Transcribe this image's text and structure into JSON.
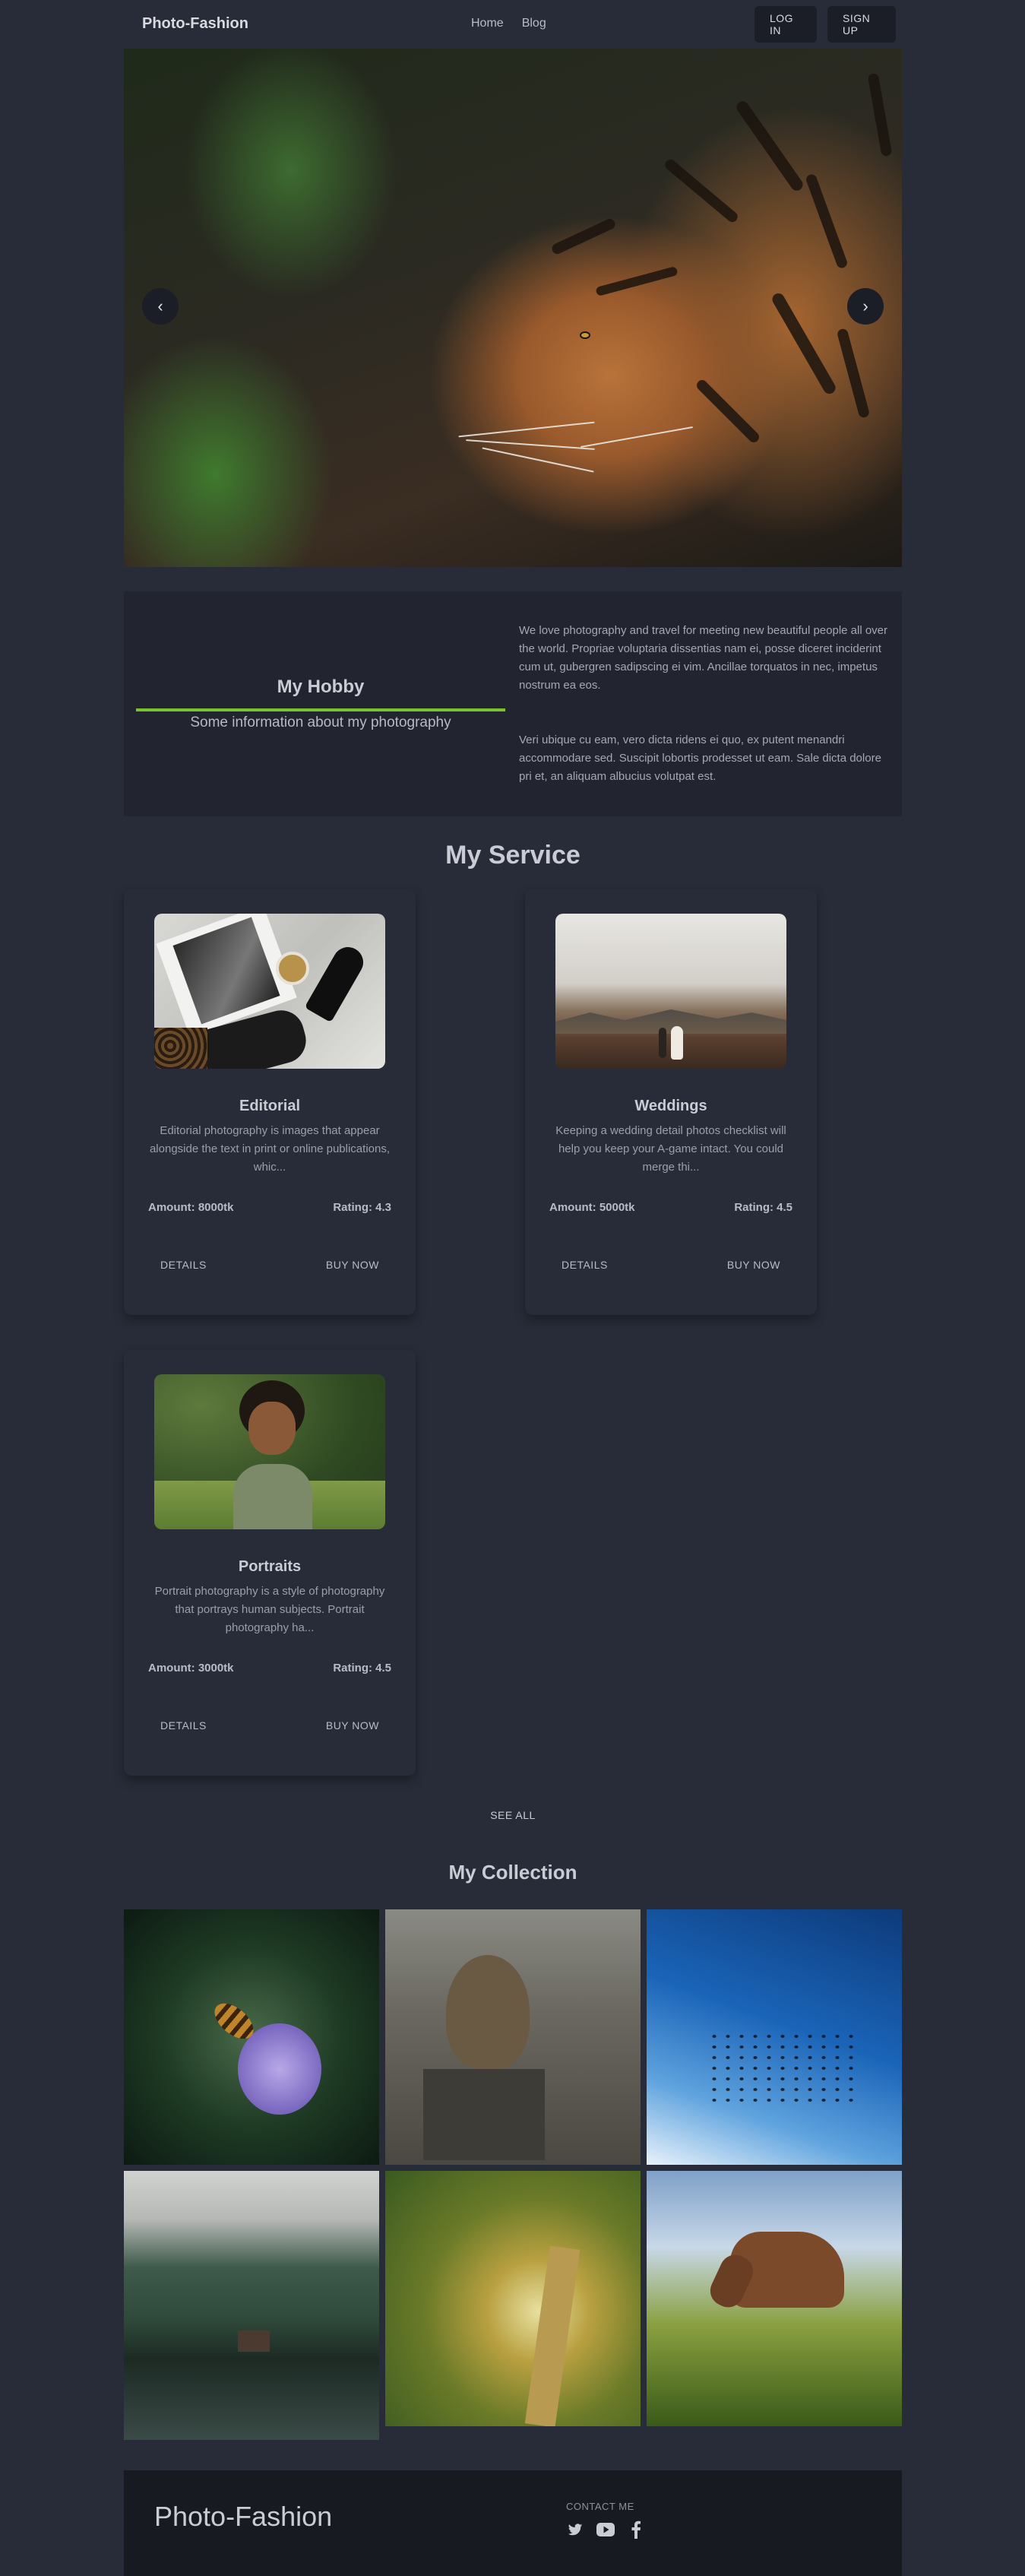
{
  "header": {
    "brand": "Photo-Fashion",
    "links": [
      "Home",
      "Blog"
    ],
    "login_label": "LOG IN",
    "signup_label": "SIGN UP"
  },
  "hero": {
    "prev_symbol": "‹",
    "next_symbol": "›",
    "image": "tiger-photo"
  },
  "hobby": {
    "title": "My Hobby",
    "subtitle": "Some information about my photography",
    "paragraph1": "We love photography and travel for meeting new beautiful people all over the world. Propriae voluptaria dissentias nam ei, posse diceret inciderint cum ut, gubergren sadipscing ei vim. Ancillae torquatos in nec, impetus nostrum ea eos.",
    "paragraph2": "Veri ubique cu eam, vero dicta ridens ei quo, ex putent menandri accommodare sed. Suscipit lobortis prodesset ut eam. Sale dicta dolore pri et, an aliquam albucius volutpat est.",
    "accent_color": "#7bc22f"
  },
  "services": {
    "title": "My Service",
    "items": [
      {
        "title": "Editorial",
        "description": "Editorial photography is images that appear alongside the text in print or online publications, whic...",
        "amount": "Amount: 8000tk",
        "rating": "Rating: 4.3",
        "details_label": "DETAILS",
        "buy_label": "BUY NOW"
      },
      {
        "title": "Weddings",
        "description": "Keeping a wedding detail photos checklist will help you keep your A-game intact. You could merge thi...",
        "amount": "Amount: 5000tk",
        "rating": "Rating: 4.5",
        "details_label": "DETAILS",
        "buy_label": "BUY NOW"
      },
      {
        "title": "Portraits",
        "description": "Portrait photography is a style of photography that portrays human subjects. Portrait photography ha...",
        "amount": "Amount: 3000tk",
        "rating": "Rating: 4.5",
        "details_label": "DETAILS",
        "buy_label": "BUY NOW"
      }
    ],
    "see_all_label": "SEE ALL"
  },
  "collection": {
    "title": "My Collection"
  },
  "footer": {
    "brand": "Photo-Fashion",
    "contact_label": "CONTACT ME",
    "socials": [
      "twitter-icon",
      "youtube-icon",
      "facebook-icon"
    ]
  },
  "colors": {
    "background": "#282c38",
    "panel": "#22252f",
    "footer": "#181a21",
    "accent": "#7bc22f"
  }
}
